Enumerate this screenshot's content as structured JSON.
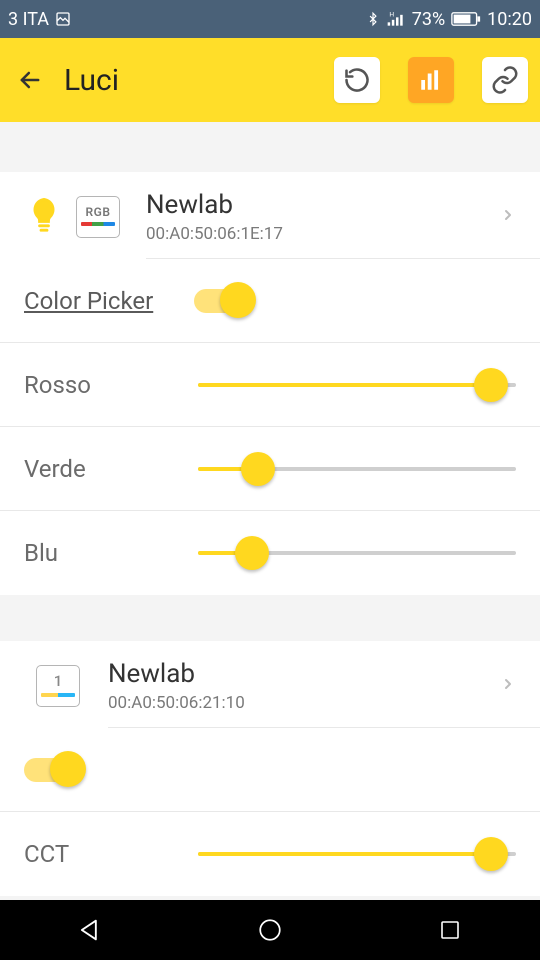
{
  "status": {
    "carrier": "3 ITA",
    "battery_pct": "73%",
    "time": "10:20"
  },
  "header": {
    "title": "Luci"
  },
  "devices": [
    {
      "badge_label": "RGB",
      "name": "Newlab",
      "mac": "00:A0:50:06:1E:17",
      "color_picker_label": "Color Picker",
      "sliders": {
        "rosso": {
          "label": "Rosso",
          "pct": 92
        },
        "verde": {
          "label": "Verde",
          "pct": 19
        },
        "blu": {
          "label": "Blu",
          "pct": 17
        }
      }
    },
    {
      "badge_num": "1",
      "name": "Newlab",
      "mac": "00:A0:50:06:21:10",
      "sliders": {
        "cct": {
          "label": "CCT",
          "pct": 92
        }
      }
    }
  ]
}
